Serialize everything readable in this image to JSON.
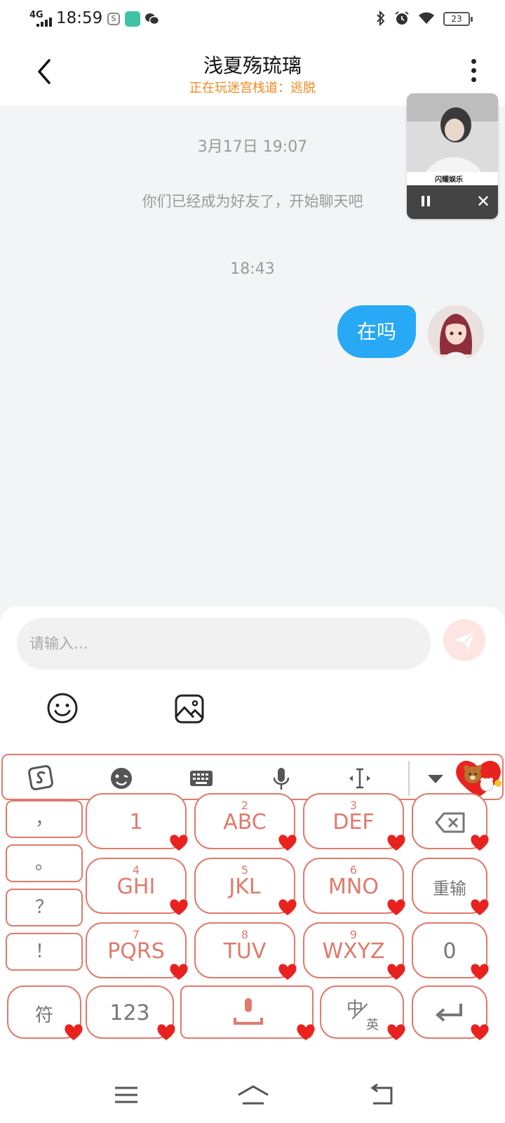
{
  "status_bar": {
    "network": "4G",
    "time": "18:59",
    "battery": "23"
  },
  "header": {
    "title": "浅夏殇琉璃",
    "subtitle": "正在玩迷宫栈道：逃脱"
  },
  "pip": {
    "caption": "闪耀娱乐"
  },
  "chat": {
    "timestamp_1": "3月17日 19:07",
    "system_message": "你们已经成为好友了，开始聊天吧",
    "timestamp_2": "18:43",
    "messages": [
      {
        "text": "在吗",
        "sender": "me"
      }
    ]
  },
  "composer": {
    "placeholder": "请输入…"
  },
  "keyboard": {
    "side_keys": [
      "，",
      "。",
      "？",
      "！"
    ],
    "rows": [
      [
        {
          "sub": "",
          "main": "1"
        },
        {
          "sub": "2",
          "main": "ABC"
        },
        {
          "sub": "3",
          "main": "DEF"
        }
      ],
      [
        {
          "sub": "4",
          "main": "GHI"
        },
        {
          "sub": "5",
          "main": "JKL"
        },
        {
          "sub": "6",
          "main": "MNO"
        }
      ],
      [
        {
          "sub": "7",
          "main": "PQRS"
        },
        {
          "sub": "8",
          "main": "TUV"
        },
        {
          "sub": "9",
          "main": "WXYZ"
        }
      ]
    ],
    "relearn": "重输",
    "zero": "0",
    "symbol": "符",
    "num_mode": "123",
    "lang_zh": "中",
    "lang_en": "英"
  },
  "colors": {
    "accent_blue": "#27a9f5",
    "keyboard_border": "#e07a6c",
    "heart": "#e8231f",
    "subtitle_orange": "#f08a1e"
  }
}
